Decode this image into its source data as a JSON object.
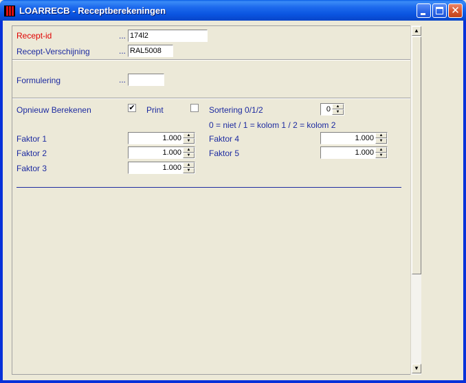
{
  "window": {
    "title": "LOARRECB - Receptberekeningen",
    "minimize_glyph": "_",
    "maximize_glyph": "",
    "close_glyph": "✕"
  },
  "recipe": {
    "recept_id_label": "Recept-id",
    "recept_id_value": "174l2",
    "recept_verschijning_label": "Recept-Verschijning",
    "recept_verschijning_value": "RAL5008",
    "dots": "..."
  },
  "formulation": {
    "label": "Formulering",
    "value": ""
  },
  "calc": {
    "recalc_label": "Opnieuw Berekenen",
    "recalc_checked": "✔",
    "print_label": "Print",
    "print_checked": "",
    "sort_label": "Sortering 0/1/2",
    "sort_value": "0",
    "sort_help": "0 = niet / 1 = kolom 1  / 2 = kolom 2",
    "factors": [
      {
        "label": "Faktor 1",
        "value": "1.000"
      },
      {
        "label": "Faktor 2",
        "value": "1.000"
      },
      {
        "label": "Faktor 3",
        "value": "1.000"
      },
      {
        "label": "Faktor 4",
        "value": "1.000"
      },
      {
        "label": "Faktor 5",
        "value": "1.000"
      }
    ]
  },
  "icons": {
    "spin_up": "▲",
    "spin_down": "▼",
    "scroll_up": "▲",
    "scroll_down": "▼"
  },
  "colors": {
    "title_bar": "#0a54e0",
    "label_blue": "#1c2aa0",
    "label_red": "#e00000",
    "face": "#ece9d8"
  }
}
